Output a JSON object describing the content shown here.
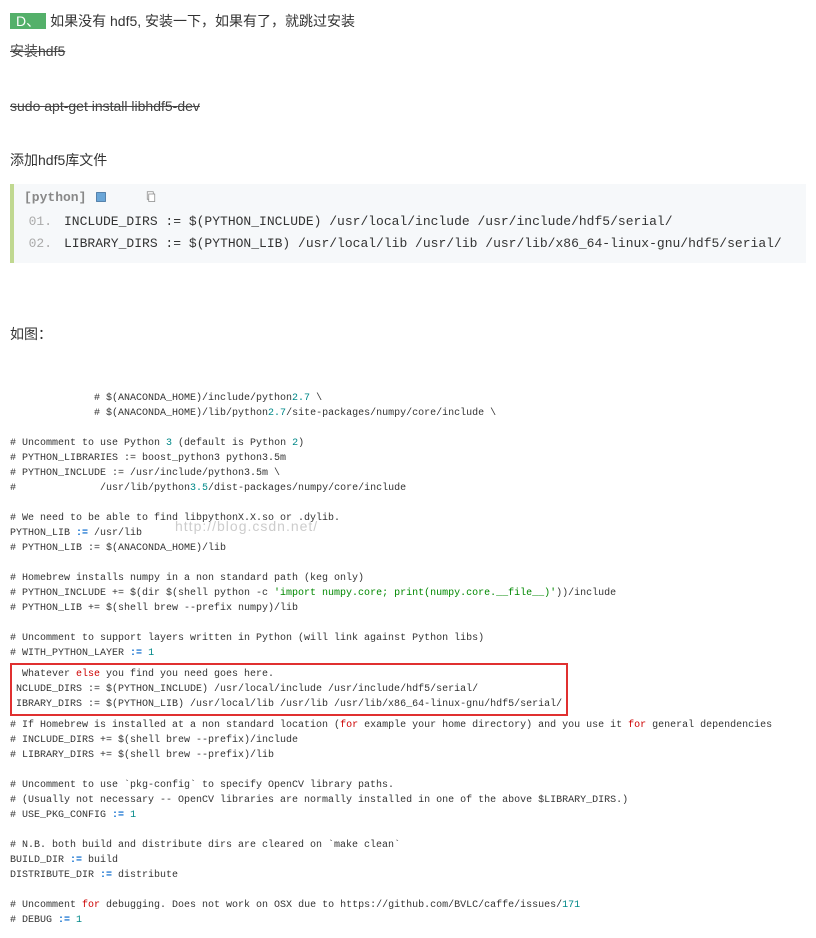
{
  "badge_d": "D、",
  "line_d": "如果没有 hdf5, 安装一下，如果有了，就跳过安装",
  "strike_1": "安装hdf5",
  "strike_2": "sudo apt-get install libhdf5-dev",
  "line_add": "添加hdf5库文件",
  "code": {
    "lang_label": "[python]",
    "lines": [
      "INCLUDE_DIRS := $(PYTHON_INCLUDE) /usr/local/include /usr/include/hdf5/serial/",
      "LIBRARY_DIRS := $(PYTHON_LIB) /usr/local/lib /usr/lib /usr/lib/x86_64-linux-gnu/hdf5/serial/"
    ]
  },
  "as_image": "如图：",
  "watermark": "http://blog.csdn.net/",
  "config": {
    "l1a": "              # $(ANACONDA_HOME)/include/python",
    "l1b": "2.7",
    "l1c": " \\",
    "l2a": "              # $(ANACONDA_HOME)/lib/python",
    "l2b": "2.7",
    "l2c": "/site-packages/numpy/core/include \\",
    "blank": " ",
    "l3a": "# Uncomment to use Python ",
    "l3b": "3",
    "l3c": " (default is Python ",
    "l3d": "2",
    "l3e": ")",
    "l4": "# PYTHON_LIBRARIES := boost_python3 python3.5m",
    "l5a": "# PYTHON_INCLUDE := /usr/include/python3.5m \\",
    "l6a": "#              /usr/lib/python",
    "l6b": "3.5",
    "l6c": "/dist-packages/numpy/core/include",
    "l7": "# We need to be able to find libpythonX.X.so or .dylib.",
    "l8a": "PYTHON_LIB ",
    "l8b": ":=",
    "l8c": " /usr/lib",
    "l9": "# PYTHON_LIB := $(ANACONDA_HOME)/lib",
    "l10": "# Homebrew installs numpy in a non standard path (keg only)",
    "l11a": "# PYTHON_INCLUDE += $(dir $(shell python -c ",
    "l11b": "'import numpy.core; print(numpy.core.__file__)'",
    "l11c": "))/include",
    "l12": "# PYTHON_LIB += $(shell brew --prefix numpy)/lib",
    "l13": "# Uncomment to support layers written in Python (will link against Python libs)",
    "l14a": "# WITH_PYTHON_LAYER ",
    "l14b": ":=",
    "l14c": " ",
    "l14d": "1",
    "box_l1a": " Whatever ",
    "box_l1b": "else",
    "box_l1c": " you find you need goes here.",
    "box_l2": "NCLUDE_DIRS := $(PYTHON_INCLUDE) /usr/local/include /usr/include/hdf5/serial/",
    "box_l3": "IBRARY_DIRS := $(PYTHON_LIB) /usr/local/lib /usr/lib /usr/lib/x86_64-linux-gnu/hdf5/serial/",
    "l15a": "# If Homebrew is installed at a non standard location (",
    "l15b": "for",
    "l15c": " example your home directory) and you use it ",
    "l15d": "for",
    "l15e": " general dependencies",
    "l16": "# INCLUDE_DIRS += $(shell brew --prefix)/include",
    "l17": "# LIBRARY_DIRS += $(shell brew --prefix)/lib",
    "l18": "# Uncomment to use `pkg-config` to specify OpenCV library paths.",
    "l19": "# (Usually not necessary -- OpenCV libraries are normally installed in one of the above $LIBRARY_DIRS.)",
    "l20a": "# USE_PKG_CONFIG ",
    "l20b": ":=",
    "l20c": " ",
    "l20d": "1",
    "l21": "# N.B. both build and distribute dirs are cleared on `make clean`",
    "l22a": "BUILD_DIR ",
    "l22b": ":=",
    "l22c": " build",
    "l23a": "DISTRIBUTE_DIR ",
    "l23b": ":=",
    "l23c": " distribute",
    "l24a": "# Uncomment ",
    "l24b": "for",
    "l24c": " debugging. Does not work on OSX due to https://github.com/BVLC/caffe/issues/",
    "l24d": "171",
    "l25a": "# DEBUG ",
    "l25b": ":=",
    "l25c": " ",
    "l25d": "1"
  }
}
